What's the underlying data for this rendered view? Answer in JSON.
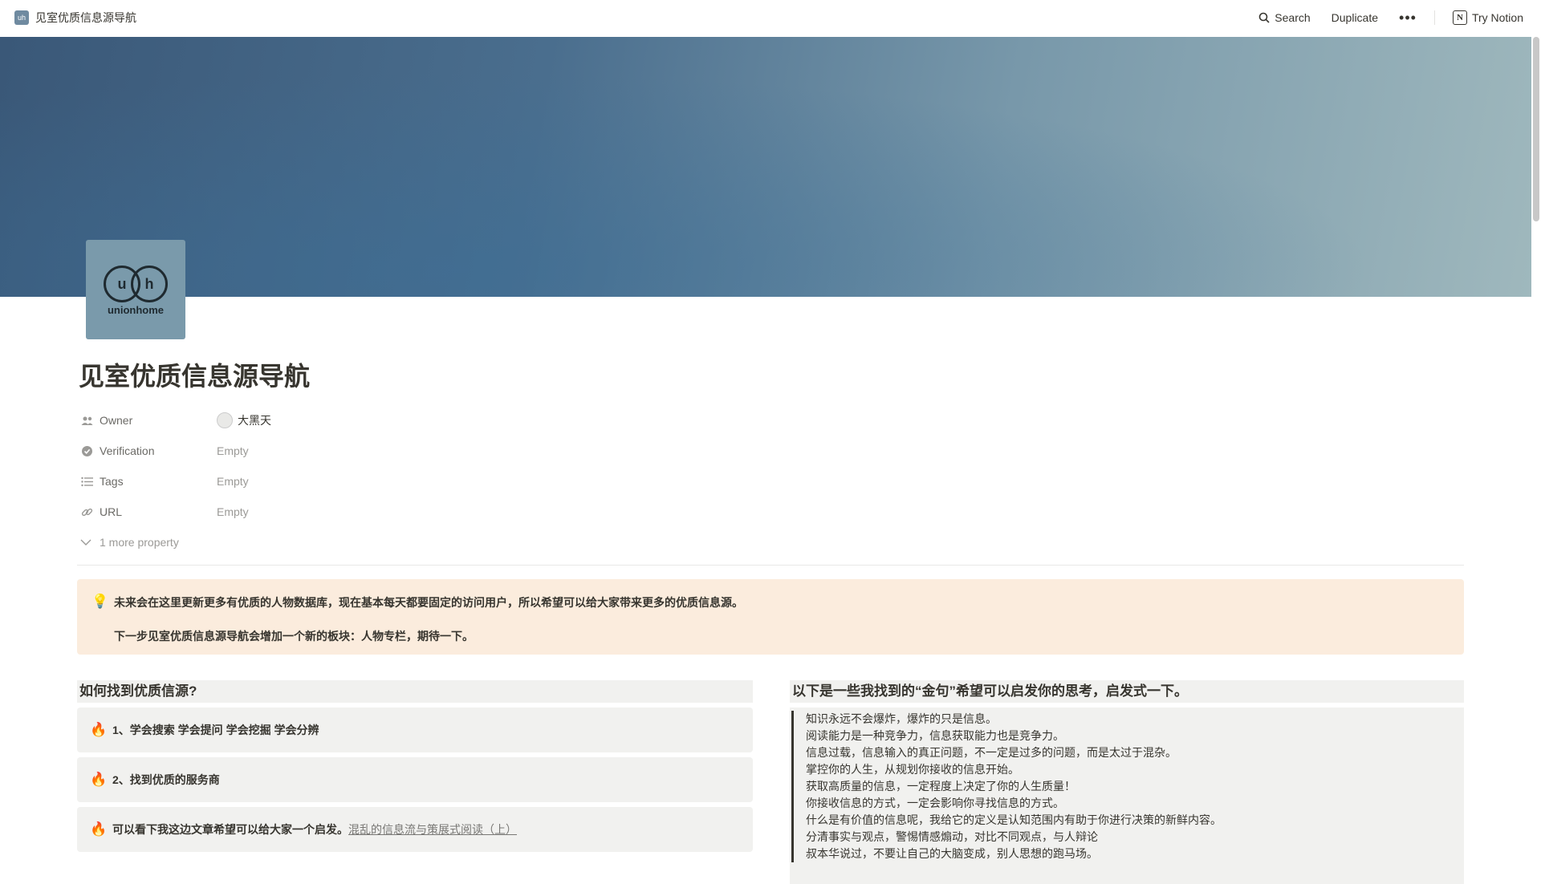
{
  "topbar": {
    "breadcrumb_title": "见室优质信息源导航",
    "search_label": "Search",
    "duplicate_label": "Duplicate",
    "more_label": "•••",
    "try_notion_label": "Try Notion"
  },
  "page": {
    "icon": {
      "letters": [
        "u",
        "h"
      ],
      "brand": "unionhome"
    },
    "title": "见室优质信息源导航"
  },
  "properties": [
    {
      "name": "Owner",
      "icon": "people-icon",
      "value": "大黑天"
    },
    {
      "name": "Verification",
      "icon": "verified-icon",
      "value": "Empty"
    },
    {
      "name": "Tags",
      "icon": "list-icon",
      "value": "Empty"
    },
    {
      "name": "URL",
      "icon": "link-icon",
      "value": "Empty"
    }
  ],
  "more_properties_label": "1 more property",
  "callout": {
    "icon": "lightbulb-icon",
    "line1": "未来会在这里更新更多有优质的人物数据库，现在基本每天都要固定的访问用户，所以希望可以给大家带来更多的优质信息源。",
    "line2": "下一步见室优质信息源导航会增加一个新的板块：人物专栏，期待一下。"
  },
  "left_column": {
    "heading": "如何找到优质信源?",
    "toggles": [
      {
        "icon": "fire-icon",
        "text": "1、学会搜索 学会提问 学会挖掘  学会分辨"
      },
      {
        "icon": "fire-icon",
        "text": "2、找到优质的服务商"
      },
      {
        "icon": "fire-icon",
        "text": "可以看下我这边文章希望可以给大家一个启发。",
        "link": "混乱的信息流与策展式阅读（上）"
      }
    ]
  },
  "right_column": {
    "heading": "以下是一些我找到的“金句”希望可以启发你的思考，启发式一下。",
    "quotes": [
      "知识永远不会爆炸，爆炸的只是信息。",
      "阅读能力是一种竞争力，信息获取能力也是竞争力。",
      "信息过载，信息输入的真正问题，不一定是过多的问题，而是太过于混杂。",
      "掌控你的人生，从规划你接收的信息开始。",
      "获取高质量的信息，一定程度上决定了你的人生质量！",
      "你接收信息的方式，一定会影响你寻找信息的方式。",
      "什么是有价值的信息呢，我给它的定义是认知范围内有助于你进行决策的新鲜内容。",
      "分清事实与观点，警惕情感煽动，对比不同观点，与人辩论",
      "叔本华说过，不要让自己的大脑变成，别人思想的跑马场。"
    ]
  }
}
